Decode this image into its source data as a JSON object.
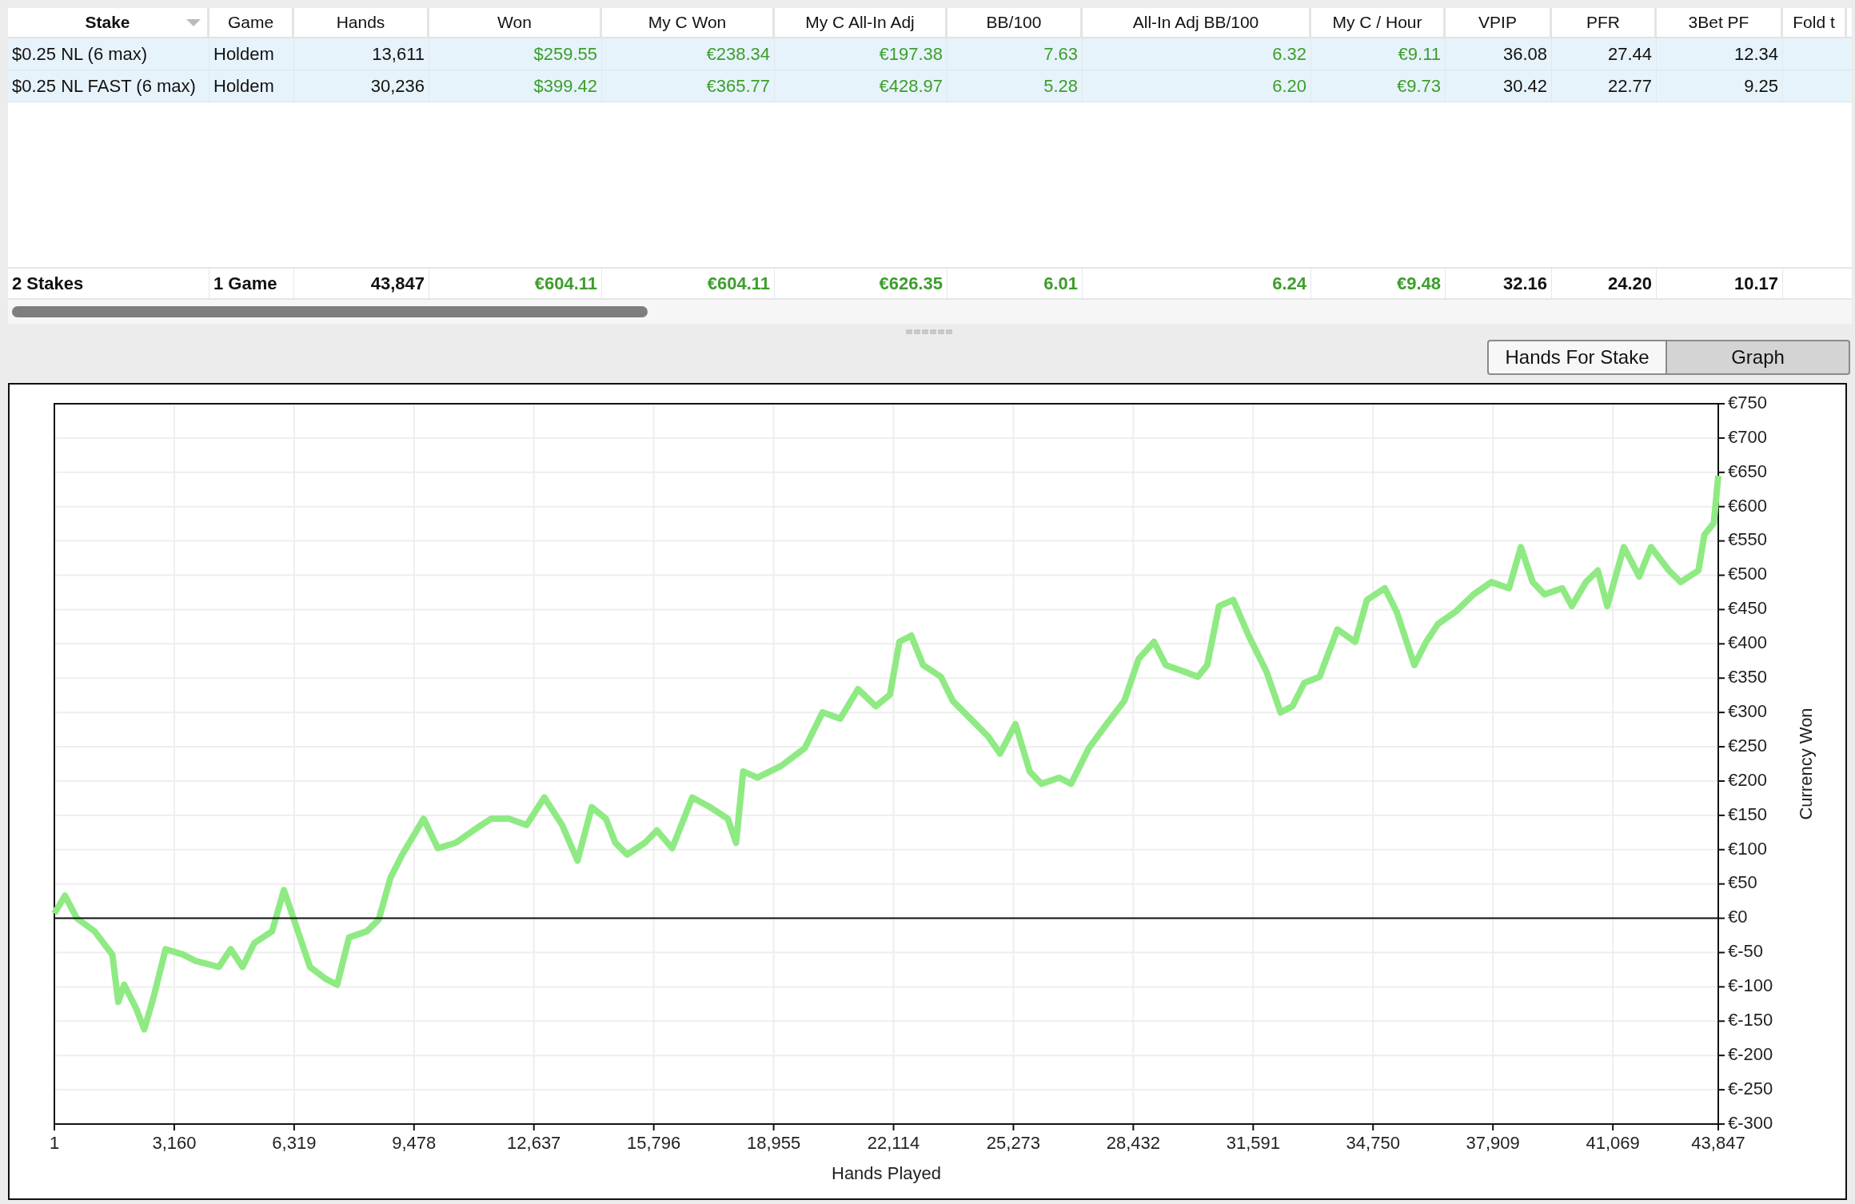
{
  "table": {
    "columns": [
      {
        "label": "Stake",
        "kind": "text",
        "sorted": true
      },
      {
        "label": "Game",
        "kind": "text",
        "sorted": false
      },
      {
        "label": "Hands",
        "kind": "number",
        "sorted": false
      },
      {
        "label": "Won",
        "kind": "result",
        "sorted": false
      },
      {
        "label": "My C Won",
        "kind": "result",
        "sorted": false
      },
      {
        "label": "My C All-In Adj",
        "kind": "result",
        "sorted": false
      },
      {
        "label": "BB/100",
        "kind": "result",
        "sorted": false
      },
      {
        "label": "All-In Adj BB/100",
        "kind": "result",
        "sorted": false
      },
      {
        "label": "My C / Hour",
        "kind": "result",
        "sorted": false
      },
      {
        "label": "VPIP",
        "kind": "number",
        "sorted": false
      },
      {
        "label": "PFR",
        "kind": "number",
        "sorted": false
      },
      {
        "label": "3Bet PF",
        "kind": "number",
        "sorted": false
      },
      {
        "label": "Fold t",
        "sorted": false
      }
    ],
    "rows": [
      {
        "selected": true,
        "cells": [
          "$0.25 NL (6 max)",
          "Holdem",
          "13,611",
          "$259.55",
          "€238.34",
          "€197.38",
          "7.63",
          "6.32",
          "€9.11",
          "36.08",
          "27.44",
          "12.34"
        ]
      },
      {
        "selected": true,
        "cells": [
          "$0.25 NL FAST (6 max)",
          "Holdem",
          "30,236",
          "$399.42",
          "€365.77",
          "€428.97",
          "5.28",
          "6.20",
          "€9.73",
          "30.42",
          "22.77",
          "9.25"
        ]
      }
    ],
    "totals": [
      "2 Stakes",
      "1 Game",
      "43,847",
      "€604.11",
      "€604.11",
      "€626.35",
      "6.01",
      "6.24",
      "€9.48",
      "32.16",
      "24.20",
      "10.17"
    ]
  },
  "tabs": [
    {
      "label": "Hands For Stake",
      "selected": false
    },
    {
      "label": "Graph",
      "selected": true
    }
  ],
  "graph": {
    "chart_data": {
      "type": "line",
      "grid": true,
      "xlabel": "Hands Played",
      "ylabel": "Currency Won",
      "xlim": [
        1,
        43847
      ],
      "ylim": [
        -300,
        750
      ],
      "xticks": [
        {
          "value": 1,
          "label": "1"
        },
        {
          "value": 3160,
          "label": "3,160"
        },
        {
          "value": 6319,
          "label": "6,319"
        },
        {
          "value": 9478,
          "label": "9,478"
        },
        {
          "value": 12637,
          "label": "12,637"
        },
        {
          "value": 15796,
          "label": "15,796"
        },
        {
          "value": 18955,
          "label": "18,955"
        },
        {
          "value": 22114,
          "label": "22,114"
        },
        {
          "value": 25273,
          "label": "25,273"
        },
        {
          "value": 28432,
          "label": "28,432"
        },
        {
          "value": 31591,
          "label": "31,591"
        },
        {
          "value": 34750,
          "label": "34,750"
        },
        {
          "value": 37909,
          "label": "37,909"
        },
        {
          "value": 41069,
          "label": "41,069"
        },
        {
          "value": 43847,
          "label": "43,847"
        }
      ],
      "yticks": [
        {
          "value": 750,
          "label": "€750"
        },
        {
          "value": 700,
          "label": "€700"
        },
        {
          "value": 650,
          "label": "€650"
        },
        {
          "value": 600,
          "label": "€600"
        },
        {
          "value": 550,
          "label": "€550"
        },
        {
          "value": 500,
          "label": "€500"
        },
        {
          "value": 450,
          "label": "€450"
        },
        {
          "value": 400,
          "label": "€400"
        },
        {
          "value": 350,
          "label": "€350"
        },
        {
          "value": 300,
          "label": "€300"
        },
        {
          "value": 250,
          "label": "€250"
        },
        {
          "value": 200,
          "label": "€200"
        },
        {
          "value": 150,
          "label": "€150"
        },
        {
          "value": 100,
          "label": "€100"
        },
        {
          "value": 50,
          "label": "€50"
        },
        {
          "value": 0,
          "label": "€0"
        },
        {
          "value": -50,
          "label": "€-50"
        },
        {
          "value": -100,
          "label": "€-100"
        },
        {
          "value": -150,
          "label": "€-150"
        },
        {
          "value": -200,
          "label": "€-200"
        },
        {
          "value": -250,
          "label": "€-250"
        },
        {
          "value": -300,
          "label": "€-300"
        }
      ],
      "x": [
        1,
        281,
        593,
        1060,
        1528,
        1684,
        1840,
        2152,
        2370,
        2620,
        2932,
        3400,
        3712,
        4335,
        4647,
        4959,
        5271,
        5739,
        6051,
        6363,
        6737,
        7142,
        7454,
        7766,
        8234,
        8546,
        8858,
        9170,
        9731,
        10106,
        10573,
        11041,
        11509,
        11977,
        12445,
        12913,
        13381,
        13786,
        14161,
        14535,
        14784,
        15096,
        15564,
        15876,
        16281,
        16811,
        17279,
        17747,
        17965,
        18152,
        18527,
        19150,
        19774,
        20243,
        20711,
        21178,
        21646,
        22020,
        22270,
        22582,
        22893,
        23361,
        23673,
        24141,
        24609,
        24921,
        25327,
        25701,
        26013,
        26481,
        26793,
        27260,
        27728,
        28196,
        28571,
        28976,
        29288,
        29756,
        30130,
        30380,
        30692,
        31066,
        31471,
        31939,
        32313,
        32625,
        32937,
        33342,
        33810,
        34278,
        34590,
        35058,
        35370,
        35838,
        36150,
        36462,
        36930,
        37397,
        37865,
        38333,
        38645,
        38957,
        39269,
        39737,
        39986,
        40360,
        40672,
        40922,
        41359,
        41764,
        42076,
        42544,
        42856,
        43324,
        43480,
        43730,
        43847
      ],
      "series": [
        {
          "color": "#8fea84",
          "values": [
            7,
            33,
            0,
            -19,
            -53,
            -122,
            -97,
            -131,
            -162,
            -114,
            -45,
            -53,
            -62,
            -71,
            -45,
            -71,
            -36,
            -19,
            41,
            -10,
            -71,
            -88,
            -97,
            -28,
            -19,
            -2,
            59,
            93,
            145,
            102,
            110,
            128,
            145,
            145,
            136,
            176,
            136,
            84,
            162,
            145,
            110,
            93,
            110,
            128,
            102,
            176,
            162,
            145,
            110,
            214,
            205,
            222,
            248,
            300,
            291,
            334,
            309,
            326,
            403,
            412,
            369,
            352,
            317,
            291,
            265,
            240,
            283,
            214,
            196,
            205,
            196,
            248,
            283,
            317,
            378,
            403,
            369,
            360,
            352,
            369,
            455,
            464,
            412,
            360,
            300,
            309,
            343,
            352,
            421,
            403,
            464,
            481,
            447,
            369,
            403,
            429,
            447,
            472,
            490,
            481,
            541,
            490,
            472,
            481,
            455,
            490,
            507,
            455,
            541,
            498,
            541,
            507,
            490,
            507,
            559,
            576,
            645
          ]
        }
      ]
    }
  }
}
